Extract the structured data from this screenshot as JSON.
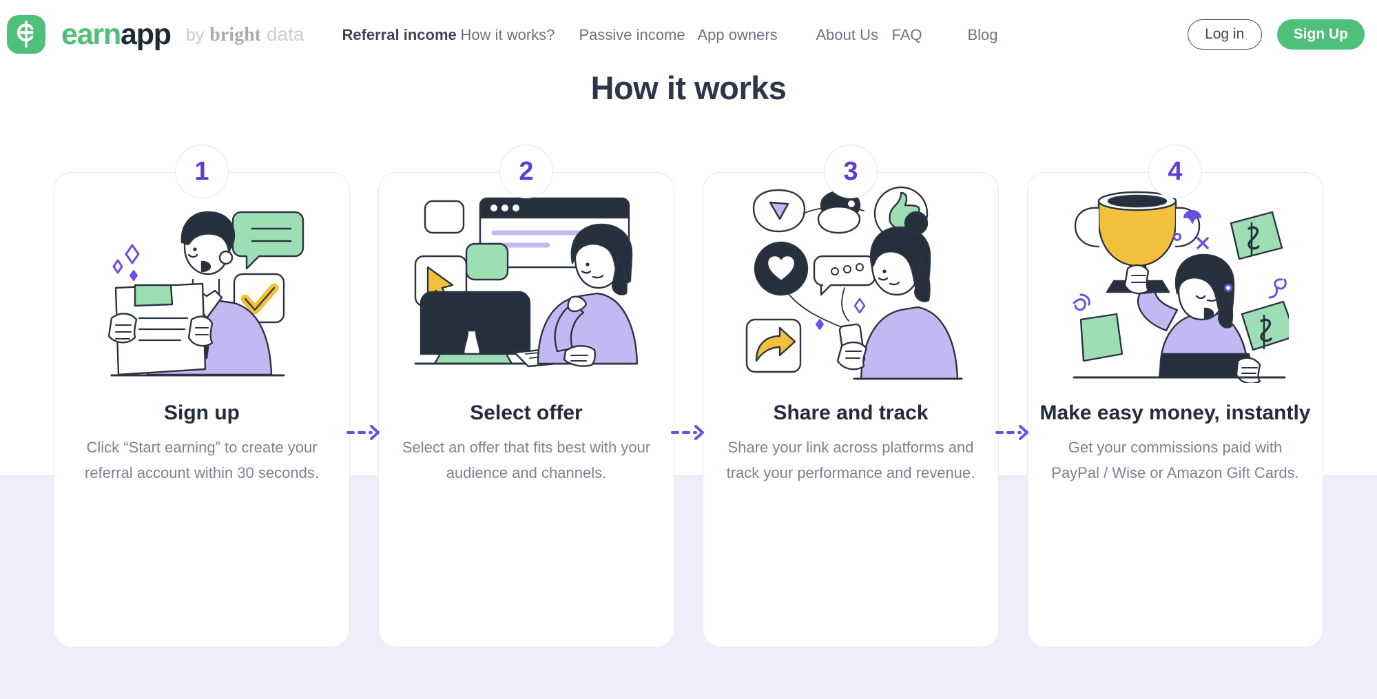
{
  "brand": {
    "logo_icon": "earnapp-e-coin-icon",
    "name_first": "earn",
    "name_second": "app",
    "by_word": "by",
    "partner_first": "bright",
    "partner_second": "data",
    "logo_color": "#4ec07a"
  },
  "nav": {
    "items": [
      {
        "label": "Referral income",
        "active": true
      },
      {
        "label": "How it works?",
        "active": false
      },
      {
        "label": "Passive income",
        "active": false
      },
      {
        "label": "App owners",
        "active": false
      },
      {
        "label": "About Us",
        "active": false
      },
      {
        "label": "FAQ",
        "active": false
      },
      {
        "label": "Blog",
        "active": false
      }
    ],
    "login_label": "Log in",
    "signup_label": "Sign Up",
    "signup_color": "#4ec07a"
  },
  "page": {
    "title": "How it works",
    "title_color": "#2b3749",
    "accent_color": "#5b3fd6",
    "band_color": "#eeeefb"
  },
  "steps": [
    {
      "number": "1",
      "title": "Sign up",
      "desc": "Click “Start earning” to create your referral account within 30 seconds.",
      "illustration": "man-reading-document-with-checkmark-illustration"
    },
    {
      "number": "2",
      "title": "Select offer",
      "desc": "Select an offer that fits best with your audience and channels.",
      "illustration": "woman-at-desktop-computer-choosing-offer-illustration"
    },
    {
      "number": "3",
      "title": "Share and track",
      "desc": "Share your link across platforms and track your performance and revenue.",
      "illustration": "woman-with-phone-social-reactions-illustration"
    },
    {
      "number": "4",
      "title": "Make easy money, instantly",
      "desc": "Get your commissions paid with PayPal / Wise or Amazon Gift Cards.",
      "illustration": "woman-holding-trophy-with-money-illustration"
    }
  ],
  "connectors": {
    "icon": "dashed-arrow-right-icon",
    "color": "#6b4fe0",
    "count": 3
  }
}
